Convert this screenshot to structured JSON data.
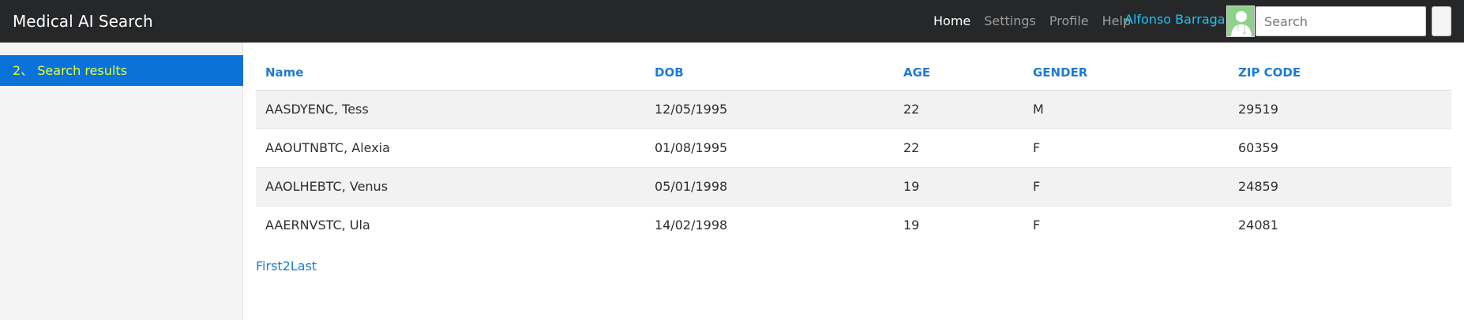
{
  "navbar": {
    "brand": "Medical AI Search",
    "links": [
      {
        "label": "Home",
        "active": true
      },
      {
        "label": "Settings",
        "active": false
      },
      {
        "label": "Profile",
        "active": false
      },
      {
        "label": "Help",
        "active": false
      }
    ],
    "user_name": "Alfonso Barragan",
    "search_placeholder": "Search"
  },
  "sidebar": {
    "items": [
      {
        "label": "2、 Search results",
        "active": true
      }
    ]
  },
  "table": {
    "headers": [
      "Name",
      "DOB",
      "AGE",
      "GENDER",
      "ZIP CODE"
    ],
    "rows": [
      [
        "AASDYENC, Tess",
        "12/05/1995",
        "22",
        "M",
        "29519"
      ],
      [
        "AAOUTNBTC, Alexia",
        "01/08/1995",
        "22",
        "F",
        "60359"
      ],
      [
        "AAOLHEBTC, Venus",
        "05/01/1998",
        "19",
        "F",
        "24859"
      ],
      [
        "AAERNVSTC, Ula",
        "14/02/1998",
        "19",
        "F",
        "24081"
      ]
    ]
  },
  "pagination": {
    "label": "First2Last"
  },
  "colors": {
    "navbar_bg": "#262729",
    "accent_blue": "#1e7bd1",
    "sidebar_active": "#0b72d9",
    "sidebar_active_text": "#e1ff3b",
    "user_name": "#1ec3f1"
  }
}
